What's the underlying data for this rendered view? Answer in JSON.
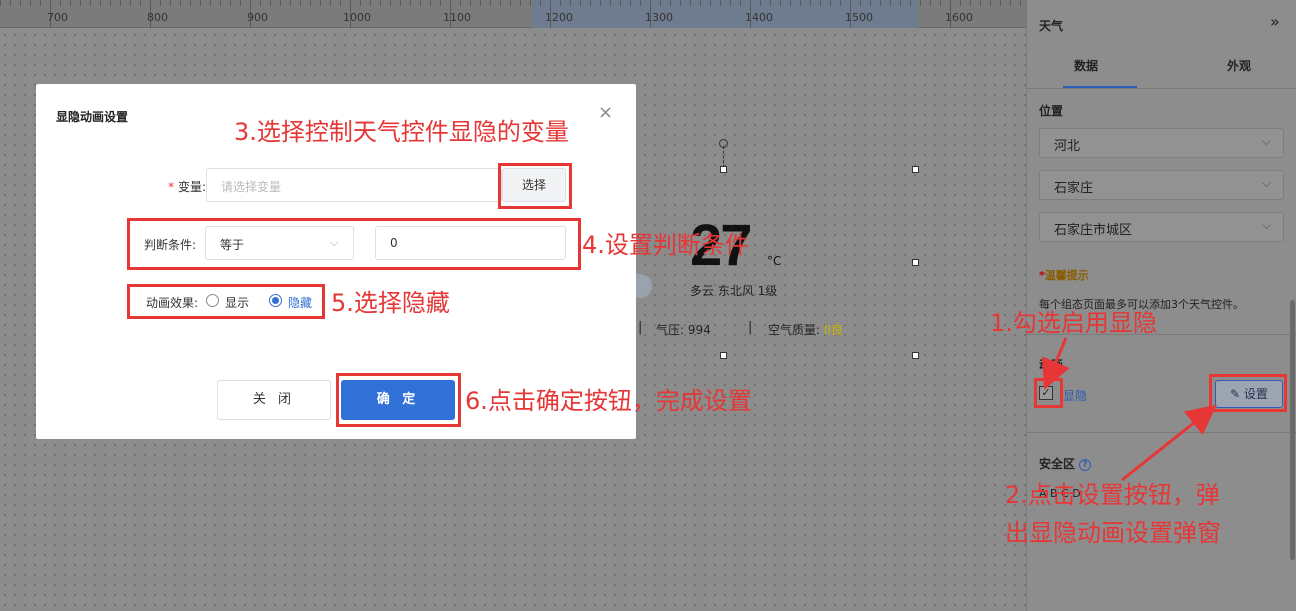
{
  "ruler": {
    "ticks": [
      "700",
      "800",
      "900",
      "1000",
      "1100",
      "1200",
      "1300",
      "1400",
      "1500",
      "1600"
    ]
  },
  "weather_widget": {
    "temperature": "27",
    "unit": "°C",
    "description": "多云   东北风 1级",
    "separator": "|",
    "pressure": "气压: 994",
    "air_quality_label": "空气质量: ",
    "air_quality_value": "II良"
  },
  "panel": {
    "title": "天气",
    "collapse_icon": "double-chevron-right-icon",
    "tabs": [
      {
        "label": "数据"
      },
      {
        "label": "外观"
      }
    ],
    "location_label": "位置",
    "province": "河北",
    "city": "石家庄",
    "district": "石家庄市城区",
    "tip_star": "*",
    "tip_title": "温馨提示",
    "tip_text": "每个组态页面最多可以添加3个天气控件。",
    "animation_label": "动画",
    "show_hide_checkbox": "显隐",
    "settings_button": "✎ 设置",
    "safe_area_label": "安全区",
    "safe_area_options": "A     B     C     D",
    "colors": {
      "accent": "#2f5db5",
      "annotation": "#e63636"
    }
  },
  "modal": {
    "title": "显隐动画设置",
    "close_icon": "×",
    "variable_req": "*",
    "variable_label": "变量:",
    "variable_placeholder": "请选择变量",
    "select_button": "选择",
    "condition_label": "判断条件:",
    "condition_operator": "等于",
    "condition_value": "0",
    "effect_label": "动画效果:",
    "effect_options": [
      {
        "label": "显示",
        "selected": false
      },
      {
        "label": "隐藏",
        "selected": true
      }
    ],
    "cancel_button": "关 闭",
    "ok_button": "确 定",
    "primary_color": "#3170d6"
  },
  "annotations": {
    "step1": "1.勾选启用显隐",
    "step2_line1": "2.点击设置按钮，弹",
    "step2_line2": "出显隐动画设置弹窗",
    "step3": "3.选择控制天气控件显隐的变量",
    "step4": "4.设置判断条件",
    "step5": "5.选择隐藏",
    "step6": "6.点击确定按钮，完成设置"
  }
}
